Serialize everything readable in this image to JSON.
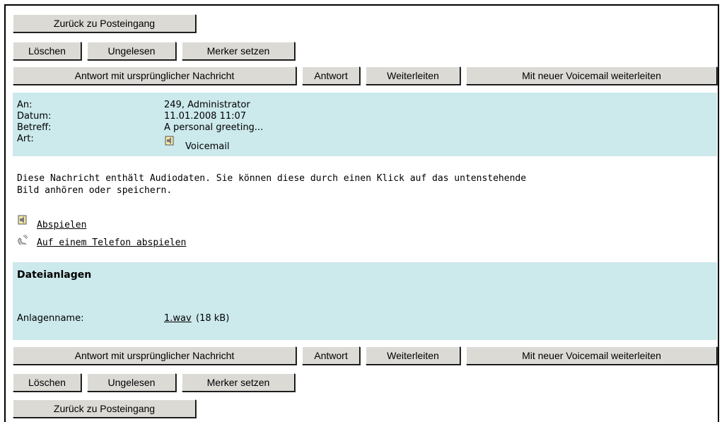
{
  "nav": {
    "back_label": "Zurück zu Posteingang"
  },
  "actions": {
    "delete_label": "Löschen",
    "unread_label": "Ungelesen",
    "flag_label": "Merker setzen"
  },
  "reply": {
    "reply_with_original_label": "Antwort mit ursprünglicher Nachricht",
    "reply_label": "Antwort",
    "forward_label": "Weiterleiten",
    "forward_voicemail_label": "Mit neuer Voicemail weiterleiten"
  },
  "header": {
    "to_label": "An:",
    "to_value": "249, Administrator",
    "date_label": "Datum:",
    "date_value": "11.01.2008 11:07",
    "subject_label": "Betreff:",
    "subject_value": "A personal greeting...",
    "type_label": "Art:",
    "type_value": "Voicemail",
    "type_icon": "voicemail-icon"
  },
  "body": {
    "line1": "Diese Nachricht enthält Audiodaten. Sie können diese durch einen Klick auf das untenstehende",
    "line2": "Bild anhören oder speichern.",
    "play_label": "Abspielen",
    "play_icon": "speaker-icon",
    "phone_play_label": "Auf einem Telefon abspielen",
    "phone_play_icon": "phone-handset-icon"
  },
  "attachments": {
    "title": "Dateianlagen",
    "name_label": "Anlagenname:",
    "file_name": "1.wav",
    "file_size": "(18 kB)"
  },
  "colors": {
    "info_bg": "#cce9ec",
    "button_bg": "#dcdad5"
  }
}
